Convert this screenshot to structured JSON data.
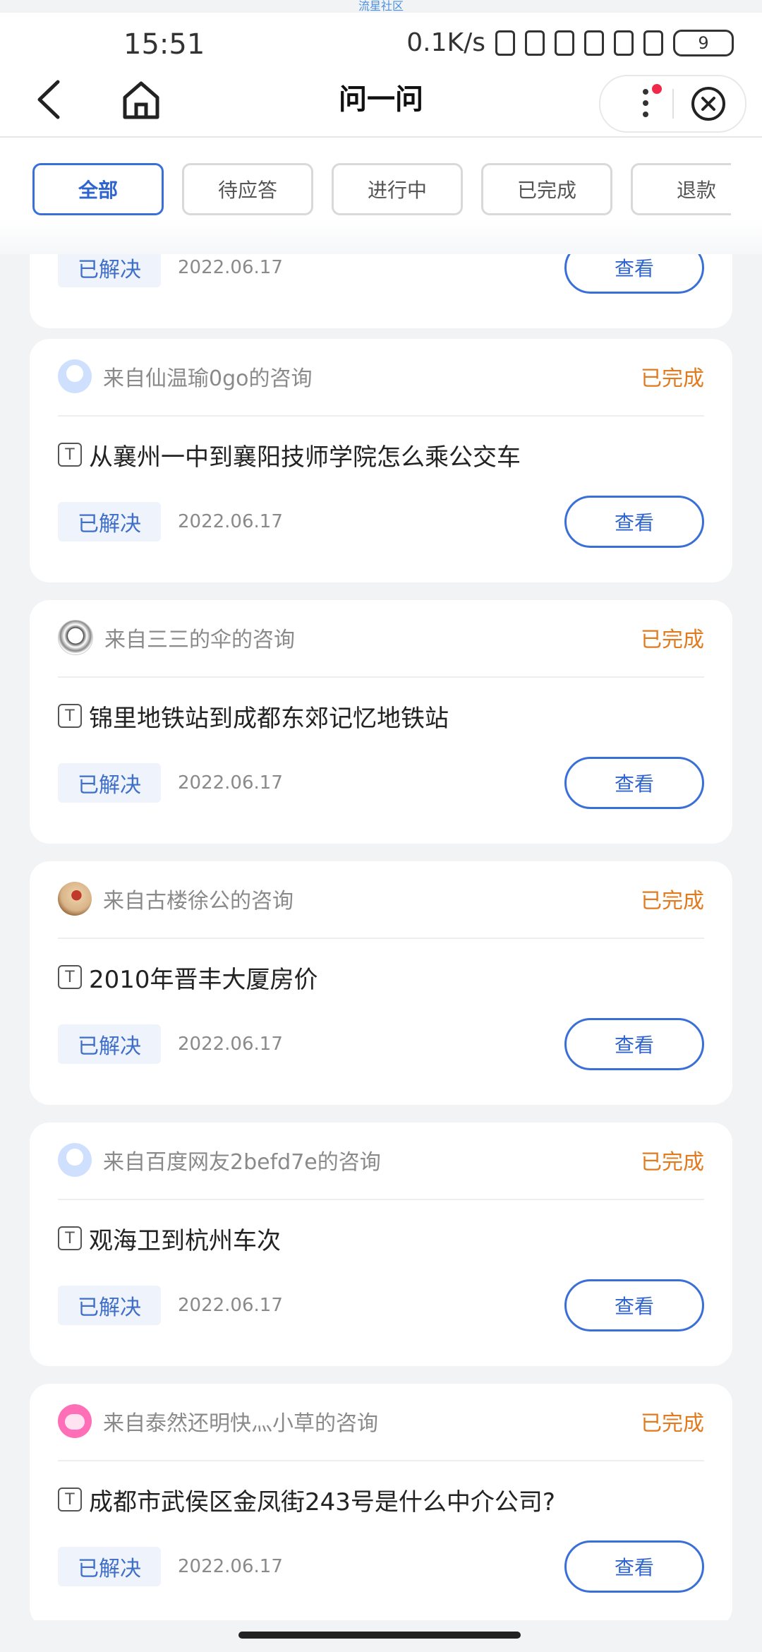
{
  "watermark": "流星社区",
  "status_bar": {
    "time": "15:51",
    "net_speed": "0.1K/s",
    "battery": "9"
  },
  "nav": {
    "title": "问一问"
  },
  "filters": [
    "全部",
    "待应答",
    "进行中",
    "已完成",
    "退款"
  ],
  "partial_card": {
    "resolved": "已解决",
    "date": "2022.06.17",
    "view": "查看"
  },
  "cards": [
    {
      "source": "来自仙温瑜0go的咨询",
      "status": "已完成",
      "t": "T",
      "question": "从襄州一中到襄阳技师学院怎么乘公交车",
      "resolved": "已解决",
      "date": "2022.06.17",
      "view": "查看"
    },
    {
      "source": "来自三三的伞的咨询",
      "status": "已完成",
      "t": "T",
      "question": "锦里地铁站到成都东郊记忆地铁站",
      "resolved": "已解决",
      "date": "2022.06.17",
      "view": "查看"
    },
    {
      "source": "来自古楼徐公的咨询",
      "status": "已完成",
      "t": "T",
      "question": "2010年晋丰大厦房价",
      "resolved": "已解决",
      "date": "2022.06.17",
      "view": "查看"
    },
    {
      "source": "来自百度网友2befd7e的咨询",
      "status": "已完成",
      "t": "T",
      "question": "观海卫到杭州车次",
      "resolved": "已解决",
      "date": "2022.06.17",
      "view": "查看"
    },
    {
      "source": "来自泰然还明快灬小草的咨询",
      "status": "已完成",
      "t": "T",
      "question": "成都市武侯区金凤街243号是什么中介公司?",
      "resolved": "已解决",
      "date": "2022.06.17",
      "view": "查看"
    }
  ]
}
